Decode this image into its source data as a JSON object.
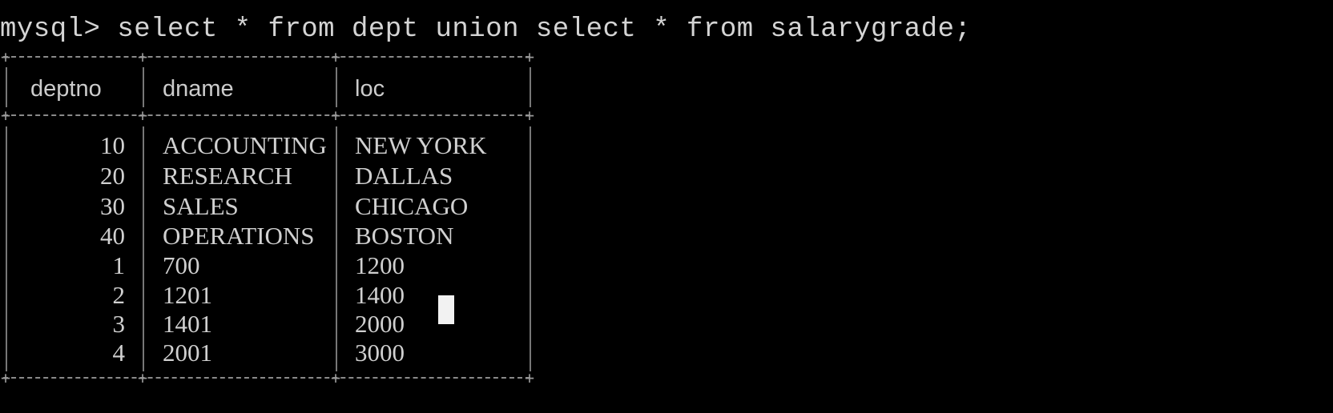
{
  "terminal": {
    "background": "#000000",
    "foreground": "#d0d0d0",
    "prompt": "mysql>",
    "command": " select * from dept union select * from salarygrade;",
    "columns": [
      "deptno",
      "dname",
      "loc"
    ],
    "rows": [
      {
        "deptno": "10",
        "dname": "ACCOUNTING",
        "loc": "NEW YORK"
      },
      {
        "deptno": "20",
        "dname": "RESEARCH",
        "loc": "DALLAS"
      },
      {
        "deptno": "30",
        "dname": "SALES",
        "loc": "CHICAGO"
      },
      {
        "deptno": "40",
        "dname": "OPERATIONS",
        "loc": "BOSTON"
      },
      {
        "deptno": "1",
        "dname": "700",
        "loc": "1200"
      },
      {
        "deptno": "2",
        "dname": "1201",
        "loc": "1400"
      },
      {
        "deptno": "3",
        "dname": "1401",
        "loc": "2000"
      },
      {
        "deptno": "4",
        "dname": "2001",
        "loc": "3000"
      }
    ]
  }
}
